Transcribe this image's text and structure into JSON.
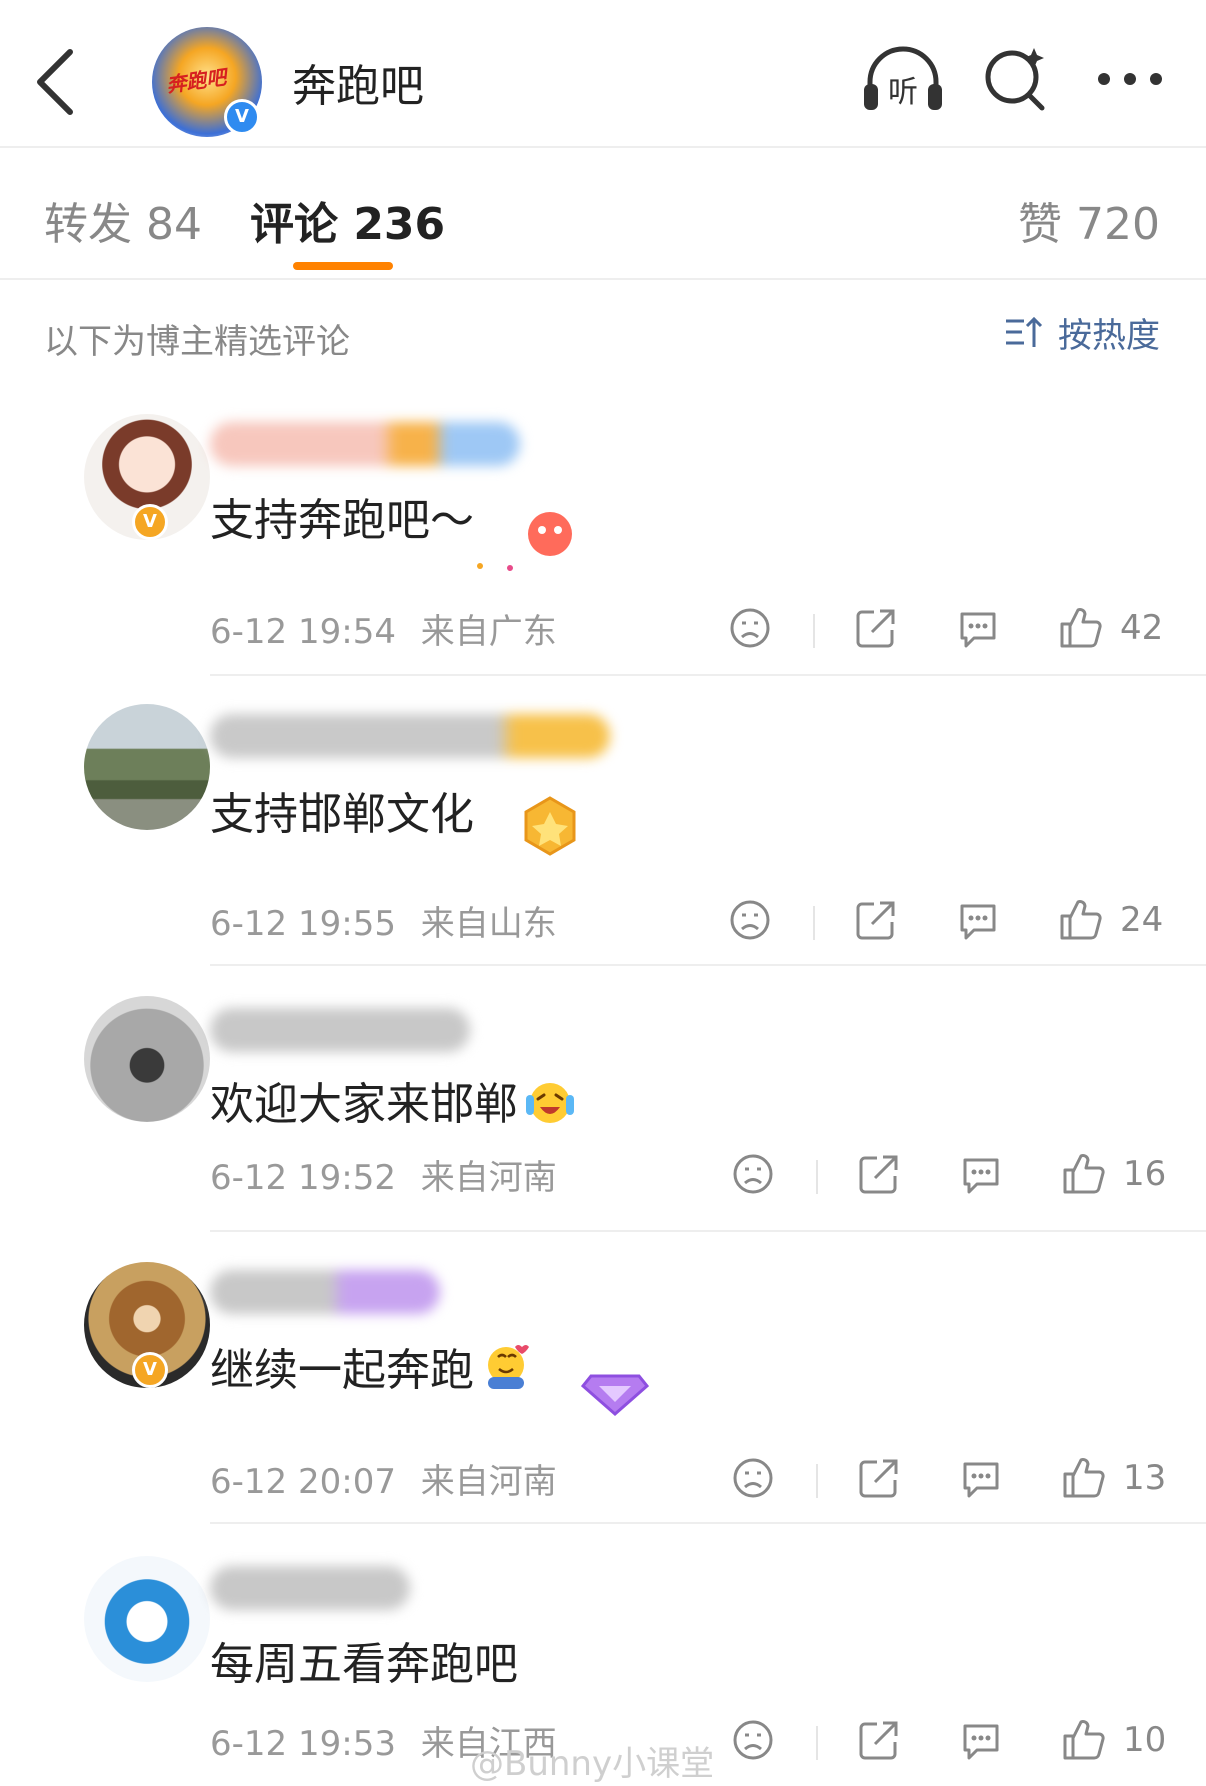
{
  "header": {
    "title": "奔跑吧",
    "avatar_logo_text": "奔跑吧"
  },
  "tabs": {
    "repost": "转发 84",
    "comments": "评论 236",
    "likes": "赞 720"
  },
  "filter": {
    "label": "以下为博主精选评论",
    "sort": "按热度"
  },
  "comments": [
    {
      "text": "支持奔跑吧～",
      "time": "6-12 19:54",
      "location": "来自广东",
      "likes": "42"
    },
    {
      "text": "支持邯郸文化",
      "time": "6-12 19:55",
      "location": "来自山东",
      "likes": "24"
    },
    {
      "text": "欢迎大家来邯郸",
      "time": "6-12 19:52",
      "location": "来自河南",
      "likes": "16"
    },
    {
      "text": "继续一起奔跑",
      "time": "6-12 20:07",
      "location": "来自河南",
      "likes": "13"
    },
    {
      "text": "每周五看奔跑吧",
      "time": "6-12 19:53",
      "location": "来自江西",
      "likes": "10"
    }
  ],
  "watermark": "@Bunny小课堂",
  "colors": {
    "accent": "#ff8200",
    "link": "#4a6a9a",
    "verified_blue": "#2f8bf0",
    "verified_gold": "#f5a623"
  }
}
